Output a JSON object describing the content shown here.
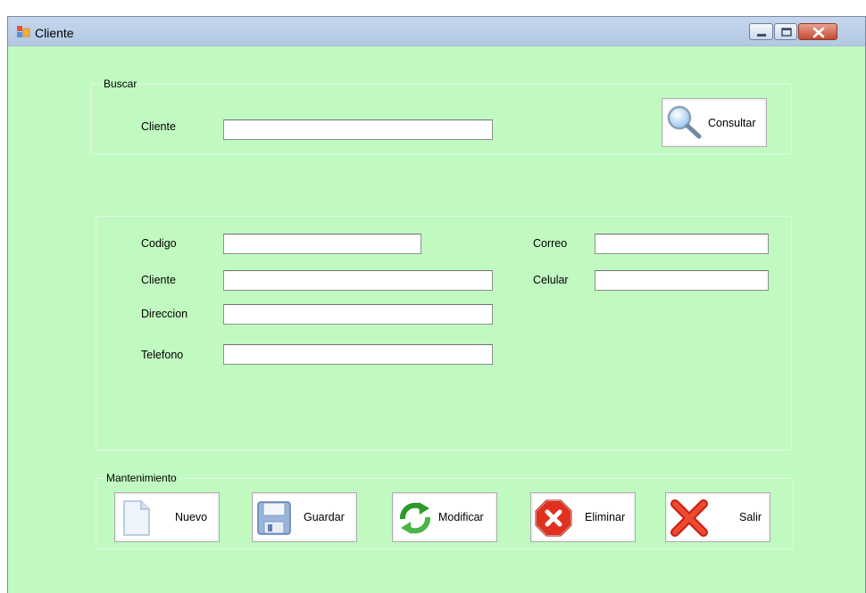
{
  "window": {
    "title": "Cliente",
    "controls": {
      "minimize": "minimize-icon",
      "maximize": "maximize-icon",
      "close": "close-icon"
    }
  },
  "buscar": {
    "group_title": "Buscar",
    "cliente_label": "Cliente",
    "cliente_value": "",
    "consultar_label": "Consultar"
  },
  "datos": {
    "codigo_label": "Codigo",
    "codigo_value": "",
    "cliente_label": "Cliente",
    "cliente_value": "",
    "direccion_label": "Direccion",
    "direccion_value": "",
    "telefono_label": "Telefono",
    "telefono_value": "",
    "correo_label": "Correo",
    "correo_value": "",
    "celular_label": "Celular",
    "celular_value": ""
  },
  "mantenimiento": {
    "group_title": "Mantenimiento",
    "nuevo_label": "Nuevo",
    "guardar_label": "Guardar",
    "modificar_label": "Modificar",
    "eliminar_label": "Eliminar",
    "salir_label": "Salir"
  },
  "colors": {
    "form_background": "#c0fac0",
    "titlebar": "#b3c8e3"
  }
}
